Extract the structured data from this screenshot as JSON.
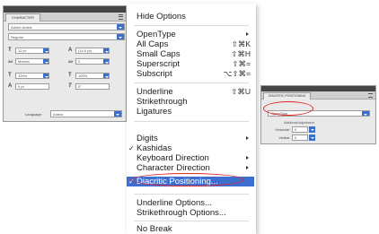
{
  "character_panel": {
    "tab": "CHARACTER",
    "font_family": "Adobe Arabic",
    "font_style": "Regular",
    "size": "12 pt",
    "leading": "(14.4 pt)",
    "kerning": "Metrics",
    "tracking": "0",
    "vertical_scale": "100%",
    "horizontal_scale": "100%",
    "baseline_shift": "0 pt",
    "skew": "0°",
    "language_label": "Language:",
    "language_value": "Arabic",
    "icons": {
      "size": "T",
      "leading": "A",
      "kerning": "AV",
      "tracking": "AV",
      "vscale": "T",
      "hscale": "T",
      "baseline": "A",
      "skew": "T"
    }
  },
  "menu": {
    "hide_options": "Hide Options",
    "opentype": "OpenType",
    "all_caps": "All Caps",
    "all_caps_shortcut": "⇧⌘K",
    "small_caps": "Small Caps",
    "small_caps_shortcut": "⇧⌘H",
    "superscript": "Superscript",
    "superscript_shortcut": "⇧⌘=",
    "subscript": "Subscript",
    "subscript_shortcut": "⌥⇧⌘=",
    "underline": "Underline",
    "underline_shortcut": "⇧⌘U",
    "strikethrough": "Strikethrough",
    "ligatures": "Ligatures",
    "digits": "Digits",
    "kashidas": "Kashidas",
    "keyboard_direction": "Keyboard Direction",
    "character_direction": "Character Direction",
    "diacritic_positioning": "Diacritic Positioning...",
    "underline_options": "Underline Options...",
    "strikethrough_options": "Strikethrough Options...",
    "no_break": "No Break",
    "check_mark": "✓",
    "highlight_color": "#3d6fd1"
  },
  "diacritic_panel": {
    "tab": "DIACRITIC POSITIONING",
    "selected": "OpenType",
    "sub_label": "Additional Adjustment",
    "horizontal_label": "Horizontal:",
    "horizontal_value": "0",
    "vertical_label": "Vertical:",
    "vertical_value": "0"
  },
  "annotation_color": "#e0262b"
}
